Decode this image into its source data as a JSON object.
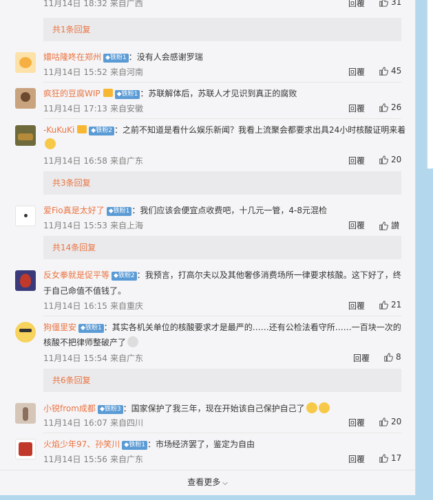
{
  "top_comment": {
    "meta": "11月14日 18:32 来自广西",
    "reply": "回覆",
    "likes": "31"
  },
  "replies_1": "共1条回复",
  "comments": [
    {
      "user": "嬛咕隆咚在郑州",
      "badge": "铁粉1",
      "text": "没有人会感谢罗瑞",
      "date": "11月14日 15:52",
      "source": "来自河南",
      "reply": "回覆",
      "likes": "45"
    },
    {
      "user": "疯狂的豆腐WIP",
      "badge": "铁粉1",
      "text": "苏联解体后，苏联人才见识到真正的腐败",
      "date": "11月14日 17:13",
      "source": "来自安徽",
      "reply": "回覆",
      "likes": "26"
    },
    {
      "user": "-KuKuKi",
      "badge": "铁粉2",
      "text": "之前不知道是看什么娱乐新闻？我看上流聚会都要求出具24小时核酸证明来着",
      "date": "11月14日 16:58",
      "source": "来自广东",
      "reply": "回覆",
      "likes": "20"
    },
    {
      "user": "爱Fio真是太好了",
      "badge": "铁粉1",
      "text": "我们应该会便宜点收费吧，十几元一管，4-8元混检",
      "date": "11月14日 15:53",
      "source": "来自上海",
      "reply": "回覆",
      "likes": "讃"
    },
    {
      "user": "反女拳就是促平等",
      "badge": "铁粉2",
      "text": "我预言，打高尔夫以及其他奢侈消费场所一律要求核酸。这下好了，终",
      "text2": "于自己命值不值钱了。",
      "date": "11月14日 16:15",
      "source": "来自重庆",
      "reply": "回覆",
      "likes": "21"
    },
    {
      "user": "狗僵里安",
      "badge": "铁粉1",
      "text": "其实各机关单位的核酸要求才是最严的……还有公检法看守所……一百块一次的",
      "text2": "核酸不把律师整破产了",
      "date": "11月14日 15:54",
      "source": "来自广东",
      "reply": "回覆",
      "likes": "8"
    },
    {
      "user": "小锐from成都",
      "badge": "铁粉3",
      "text": "国家保护了我三年，现在开始该自己保护自己了",
      "date": "11月14日 16:07",
      "source": "来自四川",
      "reply": "回覆",
      "likes": "20"
    },
    {
      "user": "火焰少年97、孙笑川",
      "badge": "铁粉1",
      "text": "市场经济罢了，鉴定为自由",
      "date": "11月14日 15:56",
      "source": "来自广东",
      "reply": "回覆",
      "likes": "17"
    }
  ],
  "replies_3": "共3条回复",
  "replies_14": "共14条回复",
  "replies_6": "共6条回复",
  "more": "查看更多",
  "colors": {
    "username": "#eb7340",
    "badge": "#5b9bd5",
    "panel": "#f5f5f7",
    "page_bg": "#b3d8ee"
  }
}
